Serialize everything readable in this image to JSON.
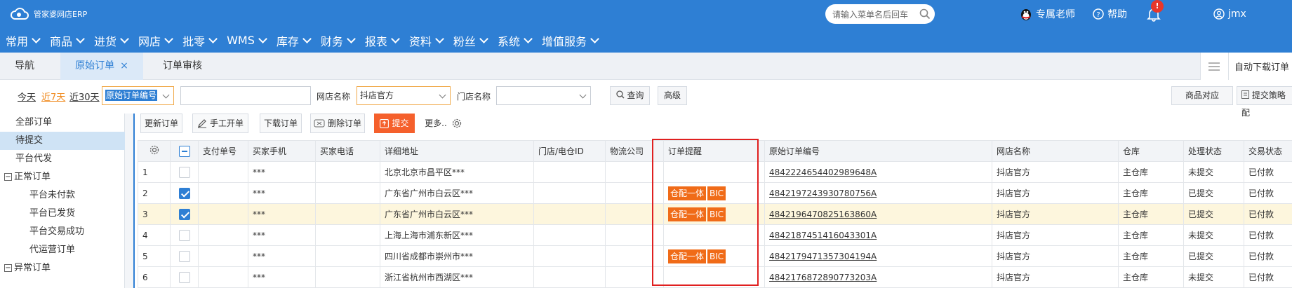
{
  "header": {
    "logo_text": "管家婆网店ERP",
    "search_placeholder": "请输入菜单名后回车",
    "teacher": "专属老师",
    "help": "帮助",
    "notification_count": "!",
    "user": "jmx",
    "brand_color": "#2e7fd4"
  },
  "menu": [
    "常用",
    "商品",
    "进货",
    "网店",
    "批零",
    "WMS",
    "库存",
    "财务",
    "报表",
    "资料",
    "粉丝",
    "系统",
    "增值服务"
  ],
  "tabs": {
    "nav": "导航",
    "active": "原始订单",
    "close": "×",
    "review": "订单审核",
    "auto_download": "自动下载订单"
  },
  "filter": {
    "today": "今天",
    "last7": "近7天",
    "last30": "近30天",
    "field_select": "原始订单编号",
    "store_label": "网店名称",
    "store_value": "抖店官方",
    "shop_label": "门店名称",
    "shop_value": "",
    "query": "查询",
    "advanced": "高级",
    "product_map": "商品对应",
    "submit_strategy": "提交策略配"
  },
  "sidebar": {
    "all": "全部订单",
    "pending": "待提交",
    "platform_ship": "平台代发",
    "normal": "正常订单",
    "normal_children": [
      "平台未付款",
      "平台已发货",
      "平台交易成功",
      "代运营订单"
    ],
    "abnormal": "异常订单",
    "toggle": "⊟"
  },
  "toolbar": {
    "update": "更新订单",
    "manual": "手工开单",
    "download": "下载订单",
    "delete": "删除订单",
    "submit": "提交",
    "more": "更多.."
  },
  "grid": {
    "columns": [
      "支付单号",
      "买家手机",
      "买家电话",
      "详细地址",
      "门店/电仓ID",
      "物流公司",
      "订单提醒",
      "原始订单编号",
      "网店名称",
      "仓库",
      "处理状态",
      "交易状态"
    ],
    "rows": [
      {
        "no": "1",
        "checked": false,
        "pay": "",
        "mobile": "***",
        "phone": "",
        "address": "北京北京市昌平区***",
        "store_id": "",
        "logistics": "",
        "tags": [],
        "order_no": "4842224654402989648A",
        "store": "抖店官方",
        "warehouse": "主仓库",
        "process": "未提交",
        "trade": "已付款"
      },
      {
        "no": "2",
        "checked": true,
        "pay": "",
        "mobile": "***",
        "phone": "",
        "address": "广东省广州市白云区***",
        "store_id": "",
        "logistics": "",
        "tags": [
          "仓配一体",
          "BIC"
        ],
        "order_no": "4842197243930780756A",
        "store": "抖店官方",
        "warehouse": "主仓库",
        "process": "已提交",
        "trade": "已付款"
      },
      {
        "no": "3",
        "checked": true,
        "pay": "",
        "mobile": "***",
        "phone": "",
        "address": "广东省广州市白云区***",
        "store_id": "",
        "logistics": "",
        "tags": [
          "仓配一体",
          "BIC"
        ],
        "order_no": "4842196470825163860A",
        "store": "抖店官方",
        "warehouse": "主仓库",
        "process": "已提交",
        "trade": "已付款"
      },
      {
        "no": "4",
        "checked": false,
        "pay": "",
        "mobile": "***",
        "phone": "",
        "address": "上海上海市浦东新区***",
        "store_id": "",
        "logistics": "",
        "tags": [],
        "order_no": "4842187451416043301A",
        "store": "抖店官方",
        "warehouse": "主仓库",
        "process": "未提交",
        "trade": "已付款"
      },
      {
        "no": "5",
        "checked": false,
        "pay": "",
        "mobile": "***",
        "phone": "",
        "address": "四川省成都市崇州市***",
        "store_id": "",
        "logistics": "",
        "tags": [
          "仓配一体",
          "BIC"
        ],
        "order_no": "4842179471357304194A",
        "store": "抖店官方",
        "warehouse": "主仓库",
        "process": "已提交",
        "trade": "已付款"
      },
      {
        "no": "6",
        "checked": false,
        "pay": "",
        "mobile": "***",
        "phone": "",
        "address": "浙江省杭州市西湖区***",
        "store_id": "",
        "logistics": "",
        "tags": [],
        "order_no": "4842176872890773203A",
        "store": "抖店官方",
        "warehouse": "主仓库",
        "process": "未提交",
        "trade": "已付款"
      }
    ],
    "highlight_row_index": 2,
    "tag_color": "#f06b18",
    "annotation_color": "#e02020"
  }
}
